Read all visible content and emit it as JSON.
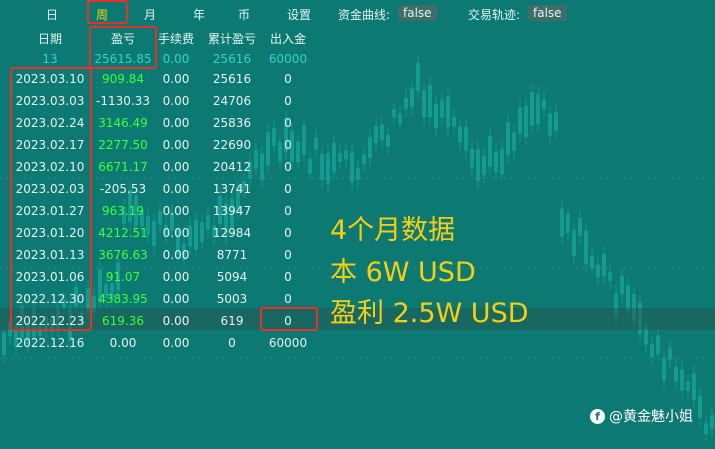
{
  "nav": {
    "tabs": [
      "日",
      "周",
      "月",
      "年",
      "币"
    ],
    "active_index": 1,
    "settings_label": "设置",
    "funds_curve_label": "资金曲线:",
    "funds_curve_value": "false",
    "trade_track_label": "交易轨迹:",
    "trade_track_value": "false"
  },
  "table": {
    "headers": [
      "日期",
      "盈亏",
      "手续费",
      "累计盈亏",
      "出入金"
    ],
    "summary": [
      "13",
      "25615.85",
      "0.00",
      "25616",
      "60000"
    ],
    "rows": [
      {
        "date": "2023.03.10",
        "pnl": "909.84",
        "fee": "0.00",
        "cum": "25616",
        "flow": "0",
        "type": "pos"
      },
      {
        "date": "2023.03.03",
        "pnl": "-1130.33",
        "fee": "0.00",
        "cum": "24706",
        "flow": "0",
        "type": "neu"
      },
      {
        "date": "2023.02.24",
        "pnl": "3146.49",
        "fee": "0.00",
        "cum": "25836",
        "flow": "0",
        "type": "pos"
      },
      {
        "date": "2023.02.17",
        "pnl": "2277.50",
        "fee": "0.00",
        "cum": "22690",
        "flow": "0",
        "type": "pos"
      },
      {
        "date": "2023.02.10",
        "pnl": "6671.17",
        "fee": "0.00",
        "cum": "20412",
        "flow": "0",
        "type": "pos"
      },
      {
        "date": "2023.02.03",
        "pnl": "-205.53",
        "fee": "0.00",
        "cum": "13741",
        "flow": "0",
        "type": "neu"
      },
      {
        "date": "2023.01.27",
        "pnl": "963.19",
        "fee": "0.00",
        "cum": "13947",
        "flow": "0",
        "type": "pos"
      },
      {
        "date": "2023.01.20",
        "pnl": "4212.51",
        "fee": "0.00",
        "cum": "12984",
        "flow": "0",
        "type": "pos"
      },
      {
        "date": "2023.01.13",
        "pnl": "3676.63",
        "fee": "0.00",
        "cum": "8771",
        "flow": "0",
        "type": "pos"
      },
      {
        "date": "2023.01.06",
        "pnl": "91.07",
        "fee": "0.00",
        "cum": "5094",
        "flow": "0",
        "type": "pos"
      },
      {
        "date": "2022.12.30",
        "pnl": "4383.95",
        "fee": "0.00",
        "cum": "5003",
        "flow": "0",
        "type": "pos"
      },
      {
        "date": "2022.12.23",
        "pnl": "619.36",
        "fee": "0.00",
        "cum": "619",
        "flow": "0",
        "type": "pos"
      },
      {
        "date": "2022.12.16",
        "pnl": "0.00",
        "fee": "0.00",
        "cum": "0",
        "flow": "60000",
        "type": "neu"
      }
    ]
  },
  "annotation": {
    "line1": "4个月数据",
    "line2": "本 6W USD",
    "line3": "盈利 2.5W USD"
  },
  "watermark": {
    "icon_letter": "f",
    "text": "@黄金魅小姐"
  },
  "colors": {
    "background": "#0c7a73",
    "positive": "#3dff3d",
    "summary": "#34d1d1",
    "accent": "#f5d20a",
    "annotation": "#f6cf13",
    "highlight_border": "#e8302a"
  }
}
